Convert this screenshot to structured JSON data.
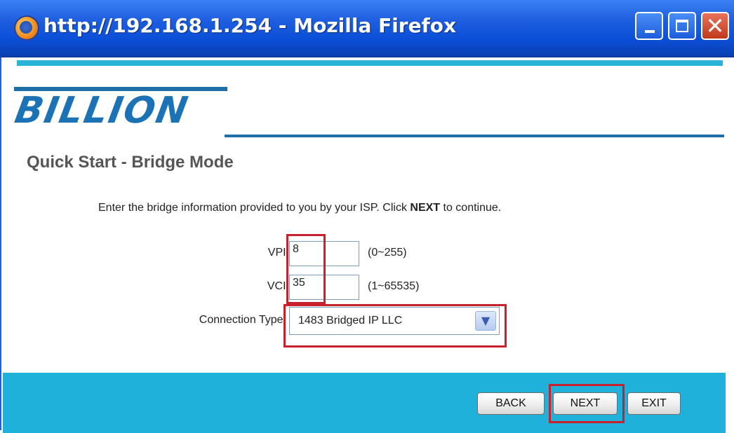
{
  "window": {
    "title": "http://192.168.1.254 - Mozilla Firefox",
    "minimize_icon": "minimize-icon",
    "maximize_icon": "maximize-icon",
    "close_icon": "close-icon",
    "close_glyph": "✕"
  },
  "brand": {
    "logo_text": "BILLION"
  },
  "page": {
    "heading": "Quick Start - Bridge Mode",
    "instruction_pre": "Enter the bridge information provided to you by your ISP. Click ",
    "instruction_bold": "NEXT",
    "instruction_post": " to continue."
  },
  "form": {
    "vpi": {
      "label": "VPI:",
      "value": "8",
      "hint": "(0~255)"
    },
    "vci": {
      "label": "VCI:",
      "value": "35",
      "hint": "(1~65535)"
    },
    "connection_type": {
      "label": "Connection Type:",
      "value": "1483 Bridged IP LLC"
    }
  },
  "buttons": {
    "back": "BACK",
    "next": "NEXT",
    "exit": "EXIT"
  },
  "colors": {
    "title_bar": "#0b4fd8",
    "accent_bar": "#1fb1da",
    "logo": "#1b72b5",
    "highlight": "#c8202c"
  }
}
